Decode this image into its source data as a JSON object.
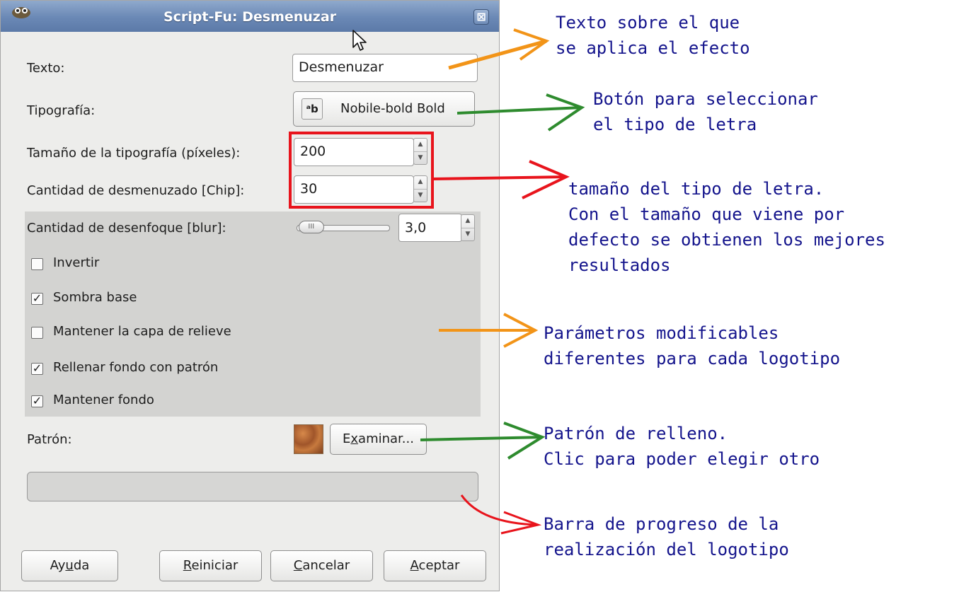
{
  "window": {
    "title": "Script-Fu: Desmenuzar",
    "close_symbol": "⊠"
  },
  "fields": {
    "texto_label": "Texto:",
    "texto_value": "Desmenuzar",
    "tipografia_label": "Tipografía:",
    "tipografia_icon_text": "ᵃb",
    "tipografia_value": "Nobile-bold Bold",
    "tamano_label": "Tamaño de la tipografía (píxeles):",
    "tamano_value": "200",
    "chip_label": "Cantidad de desmenuzado [Chip]:",
    "chip_value": "30",
    "blur_label": "Cantidad de desenfoque [blur]:",
    "blur_value": "3,0",
    "blur_level": 0.03
  },
  "checkboxes": [
    {
      "label": "Invertir",
      "checked": false,
      "mark": ""
    },
    {
      "label": "Sombra base",
      "checked": true,
      "mark": "✓"
    },
    {
      "label": "Mantener la capa de relieve",
      "checked": false,
      "mark": ""
    },
    {
      "label": "Rellenar fondo con patrón",
      "checked": true,
      "mark": "✓"
    },
    {
      "label": "Mantener fondo",
      "checked": true,
      "mark": "✓"
    }
  ],
  "pattern": {
    "label": "Patrón:",
    "browse_prefix": "E",
    "browse_underline": "x",
    "browse_suffix": "aminar..."
  },
  "progress": {
    "value": 0
  },
  "buttons": {
    "help_a": "Ay",
    "help_u": "u",
    "help_b": "da",
    "reset_u": "R",
    "reset_b": "einiciar",
    "cancel_u": "C",
    "cancel_b": "ancelar",
    "ok_u": "A",
    "ok_b": "ceptar"
  },
  "annotations": {
    "texto": "Texto sobre el que\nse aplica el efecto",
    "tipografia": "Botón para seleccionar\nel tipo de letra",
    "tamano": "tamaño del tipo de letra.\nCon el tamaño que viene por\ndefecto se obtienen los mejores\nresultados",
    "parametros": "Parámetros modificables\ndiferentes para cada logotipo",
    "patron": "Patrón de relleno.\nClic para poder elegir otro",
    "progreso": "Barra de progreso de la\nrealización del logotipo"
  },
  "colors": {
    "annotation_text": "#14148c",
    "highlight": "#e8141c",
    "arrow_orange": "#f29418",
    "arrow_green": "#2e8b2e",
    "arrow_red": "#e8141c"
  }
}
